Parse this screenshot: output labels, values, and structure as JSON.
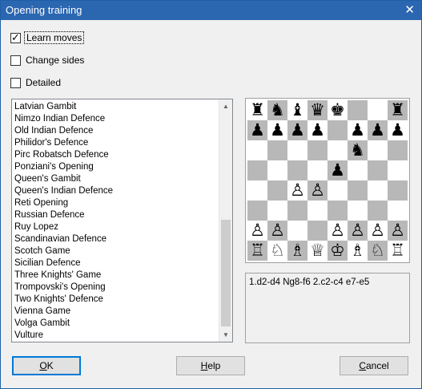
{
  "window": {
    "title": "Opening training",
    "close_glyph": "✕"
  },
  "options": {
    "learn_moves": {
      "label": "Learn moves",
      "checked": true
    },
    "change_sides": {
      "label": "Change sides",
      "checked": false
    },
    "detailed": {
      "label": "Detailed",
      "checked": false
    }
  },
  "openings": [
    "Latvian Gambit",
    "Nimzo Indian Defence",
    "Old Indian Defence",
    "Philidor's Defence",
    "Pirc Robatsch Defence",
    "Ponziani's Opening",
    "Queen's Gambit",
    "Queen's Indian Defence",
    "Reti Opening",
    "Russian Defence",
    "Ruy Lopez",
    "Scandinavian Defence",
    "Scotch Game",
    "Sicilian Defence",
    "Three Knights' Game",
    "Trompovski's Opening",
    "Two Knights' Defence",
    "Vienna Game",
    "Volga Gambit",
    "Vulture"
  ],
  "board": {
    "ranks": [
      [
        "r",
        "n",
        "b",
        "q",
        "k",
        "",
        "",
        "r"
      ],
      [
        "p",
        "p",
        "p",
        "p",
        "",
        "p",
        "p",
        "p"
      ],
      [
        "",
        "",
        "",
        "",
        "",
        "n",
        "",
        ""
      ],
      [
        "",
        "",
        "",
        "",
        "p",
        "",
        "",
        ""
      ],
      [
        "",
        "",
        "P",
        "P",
        "",
        "",
        "",
        ""
      ],
      [
        "",
        "",
        "",
        "",
        "",
        "",
        "",
        ""
      ],
      [
        "P",
        "P",
        "",
        "",
        "P",
        "P",
        "P",
        "P"
      ],
      [
        "R",
        "N",
        "B",
        "Q",
        "K",
        "B",
        "N",
        "R"
      ]
    ],
    "colors": {
      "light": "#ffffff",
      "dark": "#b8b8b8"
    }
  },
  "moves_text": "1.d2-d4 Ng8-f6 2.c2-c4 e7-e5",
  "buttons": {
    "ok": {
      "mnemonic": "O",
      "rest": "K"
    },
    "help": {
      "mnemonic": "H",
      "rest": "elp"
    },
    "cancel": {
      "mnemonic": "C",
      "rest": "ancel"
    }
  },
  "icons": {
    "scroll_up": "▲",
    "scroll_down": "▼"
  }
}
